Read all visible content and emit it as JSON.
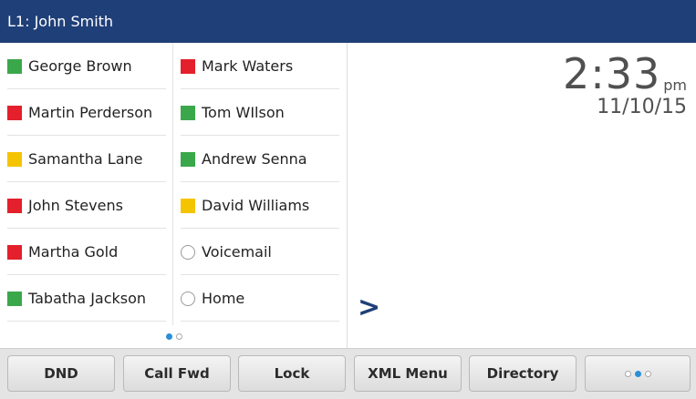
{
  "titlebar": {
    "line_label": "L1: John Smith"
  },
  "line_keys": {
    "left": [
      {
        "label": "George Brown",
        "status_color": "#3aa84a"
      },
      {
        "label": "Martin Perderson",
        "status_color": "#e3202b"
      },
      {
        "label": "Samantha Lane",
        "status_color": "#f5c400"
      },
      {
        "label": "John Stevens",
        "status_color": "#e3202b"
      },
      {
        "label": "Martha Gold",
        "status_color": "#e3202b"
      },
      {
        "label": "Tabatha Jackson",
        "status_color": "#3aa84a"
      }
    ],
    "right": [
      {
        "label": "Mark Waters",
        "status_color": "#e3202b"
      },
      {
        "label": "Tom WIlson",
        "status_color": "#3aa84a"
      },
      {
        "label": "Andrew Senna",
        "status_color": "#3aa84a"
      },
      {
        "label": "David Williams",
        "status_color": "#f5c400"
      },
      {
        "label": "Voicemail",
        "status_color": "circle"
      },
      {
        "label": "Home",
        "status_color": "circle"
      }
    ],
    "page_indicator": {
      "current": 1,
      "total": 2
    }
  },
  "clock": {
    "time": "2:33",
    "ampm": "pm",
    "date": "11/10/15"
  },
  "more_arrow": ">",
  "softkeys": [
    {
      "label": "DND"
    },
    {
      "label": "Call Fwd"
    },
    {
      "label": "Lock"
    },
    {
      "label": "XML Menu"
    },
    {
      "label": "Directory"
    }
  ],
  "softkey_pager": {
    "current": 2,
    "total": 3
  }
}
